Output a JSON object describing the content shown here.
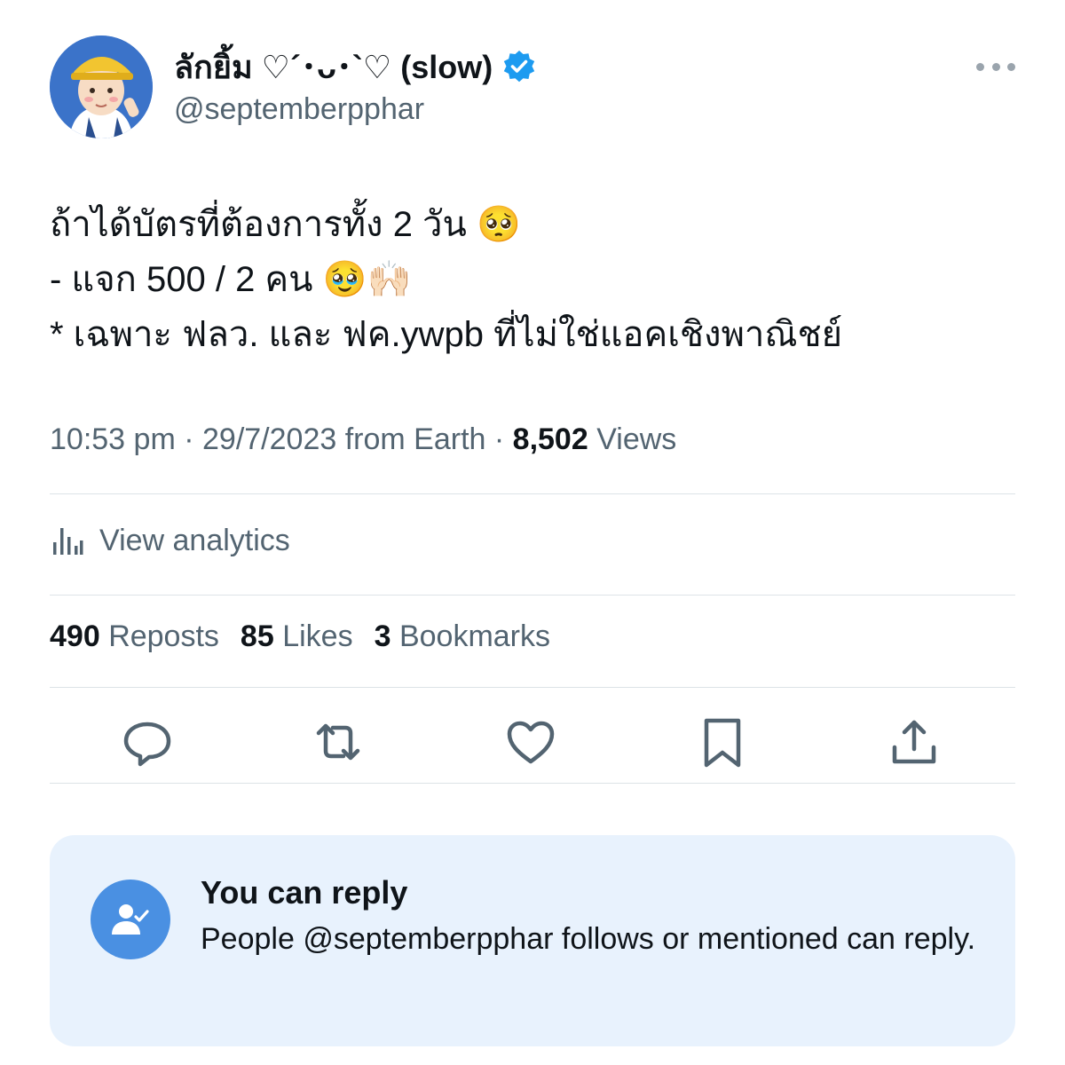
{
  "user": {
    "display_name": "ลักยิ้ม ♡´･ᴗ･`♡ (slow)",
    "handle": "@septemberpphar",
    "verified": true,
    "badge_color": "#1d9bf0"
  },
  "tweet": {
    "lines": [
      "ถ้าได้บัตรที่ต้องการทั้ง 2 วัน 🥺",
      "- แจก 500 / 2 คน 🥹🙌🏻",
      "* เฉพาะ ฟลว. และ ฟค.ywpb ที่ไม่ใช่แอคเชิงพาณิชย์"
    ]
  },
  "meta": {
    "time": "10:53 pm",
    "date": "29/7/2023",
    "source": "from Earth",
    "sep": "·",
    "views_count": "8,502",
    "views_label": "Views"
  },
  "analytics": {
    "label": "View analytics",
    "icon": "bar-chart-icon"
  },
  "stats": {
    "reposts_count": "490",
    "reposts_label": "Reposts",
    "likes_count": "85",
    "likes_label": "Likes",
    "bookmarks_count": "3",
    "bookmarks_label": "Bookmarks"
  },
  "actions": [
    "reply-icon",
    "repost-icon",
    "like-icon",
    "bookmark-icon",
    "share-icon"
  ],
  "reply_restriction": {
    "title": "You can reply",
    "description": "People @septemberpphar follows or mentioned can reply.",
    "accent_color": "#4a90e2",
    "background_color": "#e8f2fd"
  }
}
